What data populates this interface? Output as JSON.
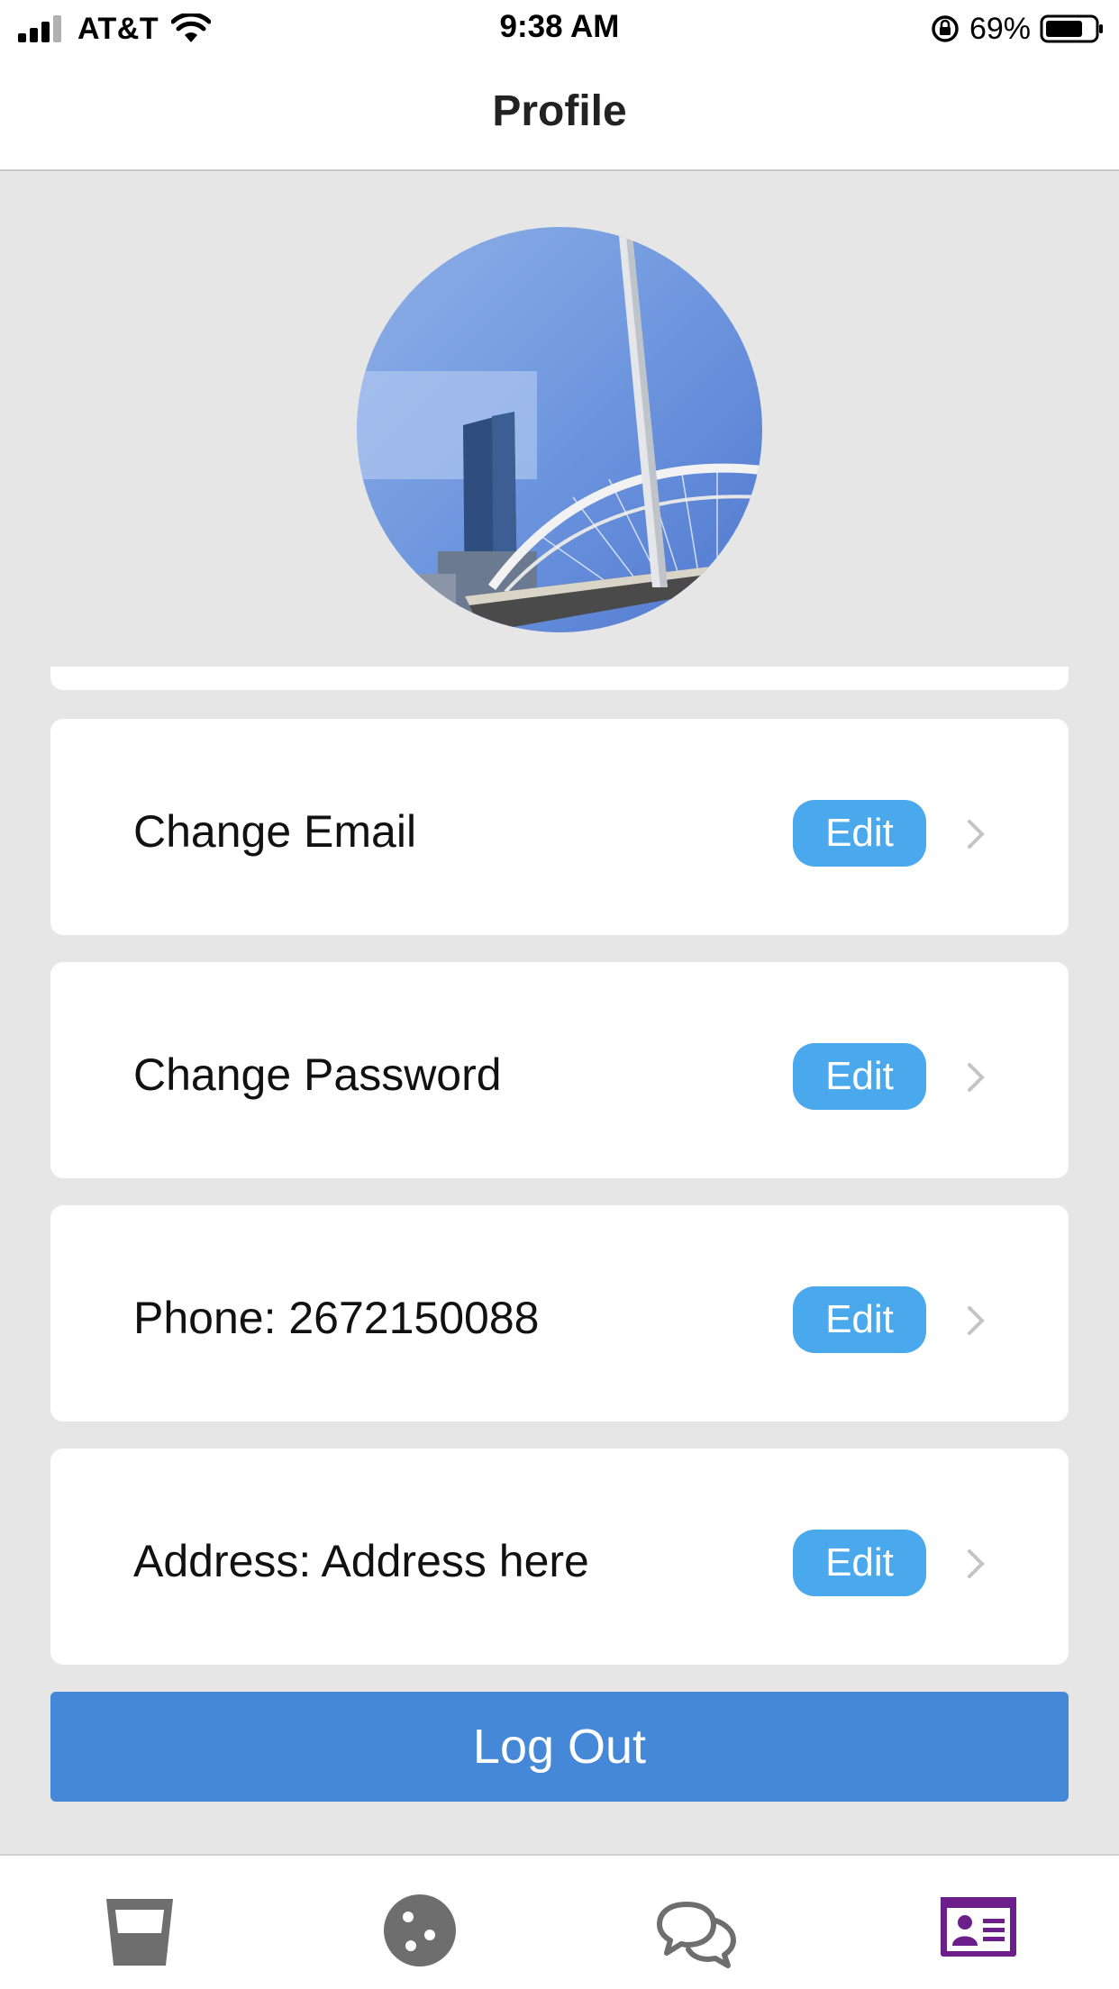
{
  "status_bar": {
    "carrier": "AT&T",
    "time": "9:38 AM",
    "battery": "69%"
  },
  "nav": {
    "title": "Profile"
  },
  "profile": {
    "avatar_icon": "profile-photo"
  },
  "settings": [
    {
      "label": "Change Email",
      "button": "Edit"
    },
    {
      "label": "Change Password",
      "button": "Edit"
    },
    {
      "label": "Phone: 2672150088",
      "button": "Edit"
    },
    {
      "label": "Address: Address here",
      "button": "Edit"
    }
  ],
  "logout_label": "Log Out",
  "tabs": [
    {
      "icon": "cup-icon",
      "active": false
    },
    {
      "icon": "cookie-icon",
      "active": false
    },
    {
      "icon": "chat-icon",
      "active": false
    },
    {
      "icon": "id-card-icon",
      "active": true
    }
  ],
  "colors": {
    "accent": "#4aa8ec",
    "logout": "#4688d8",
    "active_tab": "#6b1f8a",
    "inactive_tab": "#6e6e6e"
  }
}
